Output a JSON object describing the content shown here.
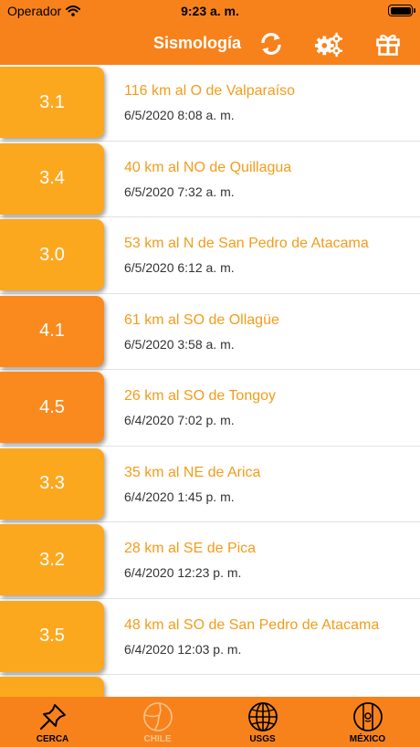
{
  "status_bar": {
    "carrier": "Operador",
    "time": "9:23 a. m."
  },
  "nav": {
    "title": "Sismología",
    "icons": [
      "refresh-icon",
      "settings-gears-icon",
      "gift-icon"
    ]
  },
  "quakes": [
    {
      "magnitude": "3.1",
      "place": "116 km al O de Valparaíso",
      "datetime": "6/5/2020 8:08 a. m.",
      "color": "#fca81f"
    },
    {
      "magnitude": "3.4",
      "place": "40 km al NO de Quillagua",
      "datetime": "6/5/2020 7:32 a. m.",
      "color": "#fca81f"
    },
    {
      "magnitude": "3.0",
      "place": "53 km al N de San Pedro de Atacama",
      "datetime": "6/5/2020 6:12 a. m.",
      "color": "#fca81f"
    },
    {
      "magnitude": "4.1",
      "place": "61 km al SO de Ollagüe",
      "datetime": "6/5/2020 3:58 a. m.",
      "color": "#fb8a1e"
    },
    {
      "magnitude": "4.5",
      "place": "26 km al SO de Tongoy",
      "datetime": "6/4/2020 7:02 p. m.",
      "color": "#fb8a1e"
    },
    {
      "magnitude": "3.3",
      "place": "35 km al NE de Arica",
      "datetime": "6/4/2020 1:45 p. m.",
      "color": "#fca81f"
    },
    {
      "magnitude": "3.2",
      "place": "28 km al SE de Pica",
      "datetime": "6/4/2020 12:23 p. m.",
      "color": "#fca81f"
    },
    {
      "magnitude": "3.5",
      "place": "48 km al SO de San Pedro de Atacama",
      "datetime": "6/4/2020 12:03 p. m.",
      "color": "#fca81f"
    },
    {
      "magnitude": "",
      "place": "",
      "datetime": "",
      "color": "#fca81f"
    }
  ],
  "tabs": [
    {
      "label": "CERCA",
      "icon": "pin-icon",
      "active": false
    },
    {
      "label": "CHILE",
      "icon": "chile-map-icon",
      "active": true
    },
    {
      "label": "USGS",
      "icon": "globe-icon",
      "active": false
    },
    {
      "label": "MÉXICO",
      "icon": "mexico-flag-icon",
      "active": false
    }
  ]
}
